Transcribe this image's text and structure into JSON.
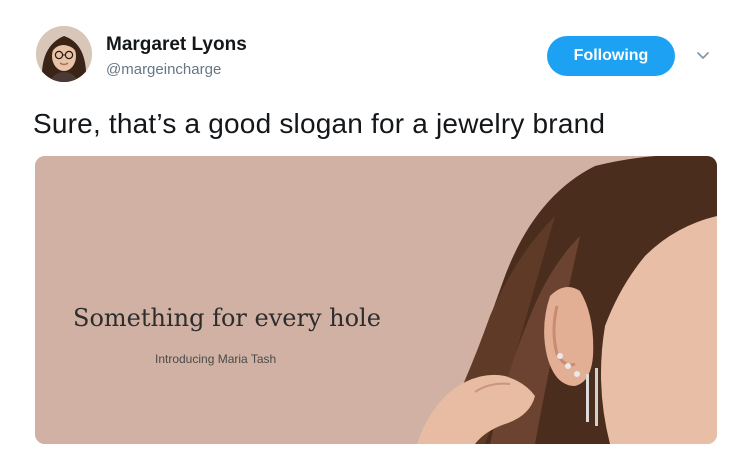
{
  "user": {
    "display_name": "Margaret Lyons",
    "handle": "@margeincharge"
  },
  "follow_button": {
    "label": "Following"
  },
  "tweet": {
    "text": "Sure, that’s a good slogan for a jewelry brand"
  },
  "media": {
    "headline": "Something for every hole",
    "subline": "Introducing Maria Tash"
  },
  "icons": {
    "caret": "chevron-down-icon"
  },
  "colors": {
    "accent": "#1da1f2",
    "text": "#14171a",
    "secondary": "#657786",
    "ad_background": "#d1b1a3"
  }
}
